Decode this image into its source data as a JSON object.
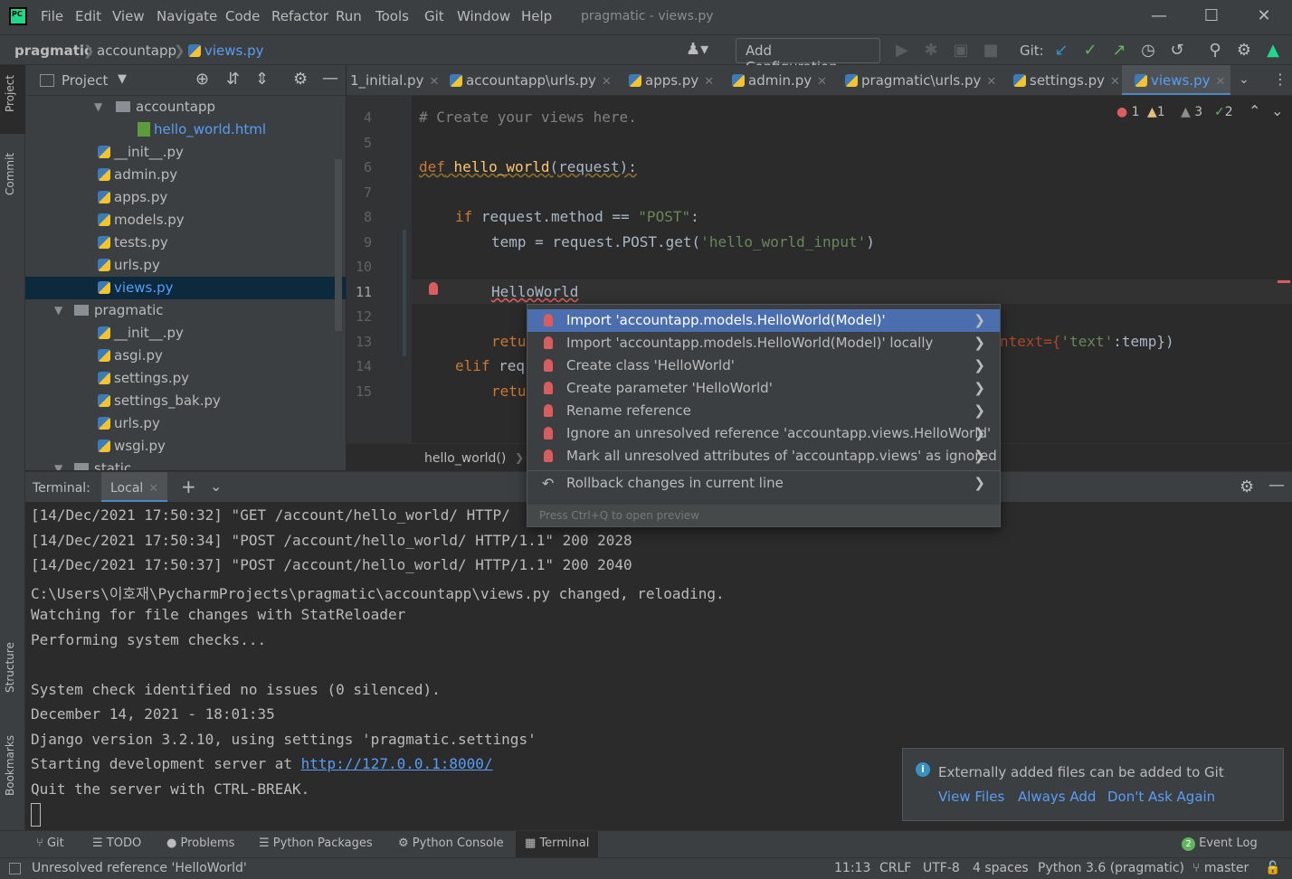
{
  "app": {
    "logo": "PC",
    "window_title": "pragmatic - views.py",
    "menu": [
      "File",
      "Edit",
      "View",
      "Navigate",
      "Code",
      "Refactor",
      "Run",
      "Tools",
      "Git",
      "Window",
      "Help"
    ]
  },
  "navbar": {
    "breadcrumbs": [
      "pragmatic",
      "accountapp",
      "views.py"
    ],
    "add_configuration": "Add Configuration...",
    "git_label": "Git:"
  },
  "side_strip": {
    "left": [
      "Project",
      "Commit",
      "Structure",
      "Bookmarks"
    ]
  },
  "project_panel": {
    "title": "Project",
    "tree": [
      {
        "label": "accountapp",
        "kind": "folder",
        "level": 3
      },
      {
        "label": "hello_world.html",
        "kind": "html",
        "level": 5
      },
      {
        "label": "__init__.py",
        "kind": "py",
        "level": 4
      },
      {
        "label": "admin.py",
        "kind": "py",
        "level": 4
      },
      {
        "label": "apps.py",
        "kind": "py",
        "level": 4
      },
      {
        "label": "models.py",
        "kind": "py",
        "level": 4
      },
      {
        "label": "tests.py",
        "kind": "py",
        "level": 4
      },
      {
        "label": "urls.py",
        "kind": "py",
        "level": 4
      },
      {
        "label": "views.py",
        "kind": "py",
        "level": 4,
        "selected": true
      },
      {
        "label": "pragmatic",
        "kind": "folder",
        "level": 2
      },
      {
        "label": "__init__.py",
        "kind": "py",
        "level": 4
      },
      {
        "label": "asgi.py",
        "kind": "py",
        "level": 4
      },
      {
        "label": "settings.py",
        "kind": "py",
        "level": 4
      },
      {
        "label": "settings_bak.py",
        "kind": "py",
        "level": 4
      },
      {
        "label": "urls.py",
        "kind": "py",
        "level": 4
      },
      {
        "label": "wsgi.py",
        "kind": "py",
        "level": 4
      },
      {
        "label": "static",
        "kind": "folder",
        "level": 2
      }
    ]
  },
  "tabs": [
    {
      "label": "1_initial.py",
      "active": false
    },
    {
      "label": "accountapp\\urls.py",
      "active": false
    },
    {
      "label": "apps.py",
      "active": false
    },
    {
      "label": "admin.py",
      "active": false
    },
    {
      "label": "pragmatic\\urls.py",
      "active": false
    },
    {
      "label": "settings.py",
      "active": false
    },
    {
      "label": "views.py",
      "active": true
    }
  ],
  "inspections": {
    "errors": "1",
    "warnings": "1",
    "weak_warnings": "3",
    "ok": "2"
  },
  "editor": {
    "line_numbers": [
      "4",
      "5",
      "6",
      "7",
      "8",
      "9",
      "10",
      "11",
      "12",
      "13",
      "14",
      "15"
    ],
    "lines": {
      "l4": "# Create your views here.",
      "l6_kw": "def",
      "l6_fn": "hello_world",
      "l6_rest": "(request):",
      "l8_kw": "if",
      "l8_mid": " request.method == ",
      "l8_str": "\"POST\"",
      "l8_end": ":",
      "l9_a": "temp = request.POST.get(",
      "l9_str": "'hello_world_input'",
      "l9_b": ")",
      "l11": "HelloWorld",
      "l13": "retu",
      "l13_tail_a": "ntext={",
      "l13_tail_str": "'text'",
      "l13_tail_b": ":temp})",
      "l14_kw": "elif",
      "l14_rest": " req",
      "l15": "retu"
    },
    "breadcrumb": "hello_world()"
  },
  "popup": {
    "items": [
      "Import 'accountapp.models.HelloWorld(Model)'",
      "Import 'accountapp.models.HelloWorld(Model)' locally",
      "Create class 'HelloWorld'",
      "Create parameter 'HelloWorld'",
      "Rename reference",
      "Ignore an unresolved reference 'accountapp.views.HelloWorld'",
      "Mark all unresolved attributes of 'accountapp.views' as ignored"
    ],
    "rollback": "Rollback changes in current line",
    "hint": "Press Ctrl+Q to open preview"
  },
  "terminal": {
    "label": "Terminal:",
    "tab": "Local",
    "lines": [
      "[14/Dec/2021 17:50:32] \"GET /account/hello_world/ HTTP/",
      "[14/Dec/2021 17:50:34] \"POST /account/hello_world/ HTTP/1.1\" 200 2028",
      "[14/Dec/2021 17:50:37] \"POST /account/hello_world/ HTTP/1.1\" 200 2040",
      "C:\\Users\\이호재\\PycharmProjects\\pragmatic\\accountapp\\views.py changed, reloading.",
      "Watching for file changes with StatReloader",
      "Performing system checks...",
      "",
      "System check identified no issues (0 silenced).",
      "December 14, 2021 - 18:01:35",
      "Django version 3.2.10, using settings 'pragmatic.settings'"
    ],
    "server_prefix": "Starting development server at ",
    "server_url": "http://127.0.0.1:8000/",
    "quit_line": "Quit the server with CTRL-BREAK."
  },
  "notification": {
    "message": "Externally added files can be added to Git",
    "actions": [
      "View Files",
      "Always Add",
      "Don't Ask Again"
    ]
  },
  "tool_windows": [
    "Git",
    "TODO",
    "Problems",
    "Python Packages",
    "Python Console",
    "Terminal"
  ],
  "event_log": {
    "count": "2",
    "label": "Event Log"
  },
  "status": {
    "message": "Unresolved reference 'HelloWorld'",
    "position": "11:13",
    "line_sep": "CRLF",
    "encoding": "UTF-8",
    "indent": "4 spaces",
    "interpreter": "Python 3.6 (pragmatic)",
    "branch": "master"
  },
  "colors": {
    "accent": "#4b6eaf",
    "error": "#db5c5c",
    "warning": "#e5c07b",
    "ok": "#5fb65f",
    "link": "#589df6"
  }
}
